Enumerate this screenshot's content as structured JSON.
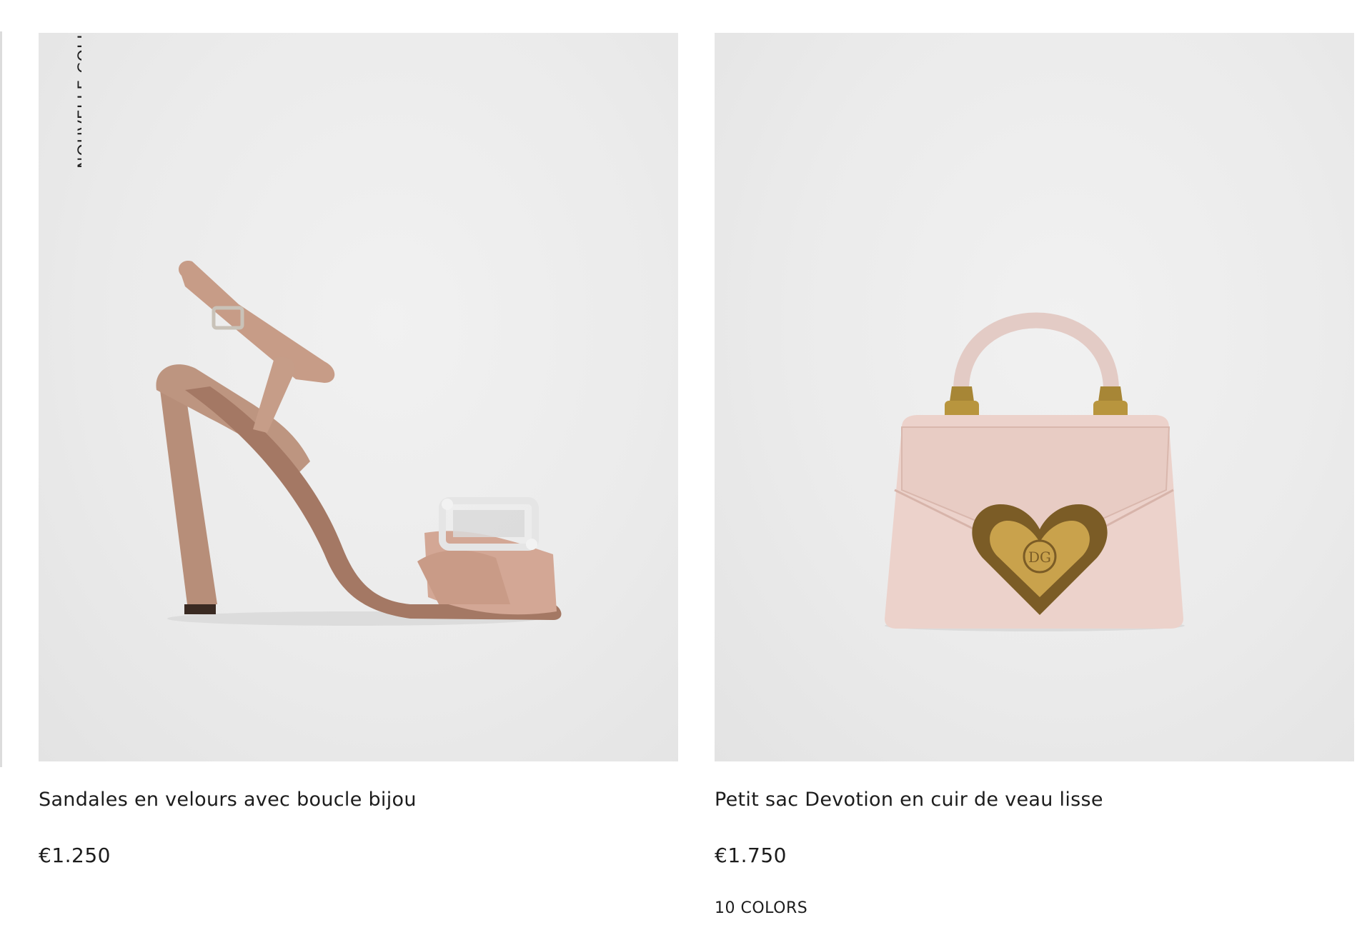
{
  "products": [
    {
      "badge": "NOUVELLE COLL",
      "title": "Sandales en velours avec boucle bijou",
      "price": "€1.250",
      "image_icon": "heeled-sandal-image"
    },
    {
      "title": "Petit sac Devotion en cuir de veau lisse",
      "price": "€1.750",
      "colors": "10 COLORS",
      "image_icon": "handbag-image"
    }
  ],
  "colors": {
    "background": "#ffffff",
    "image_bg": "#ebebeb",
    "text": "#1c1c1c",
    "sandal": "#c9a08b",
    "bag": "#ecd1ca",
    "gold": "#a78636"
  }
}
